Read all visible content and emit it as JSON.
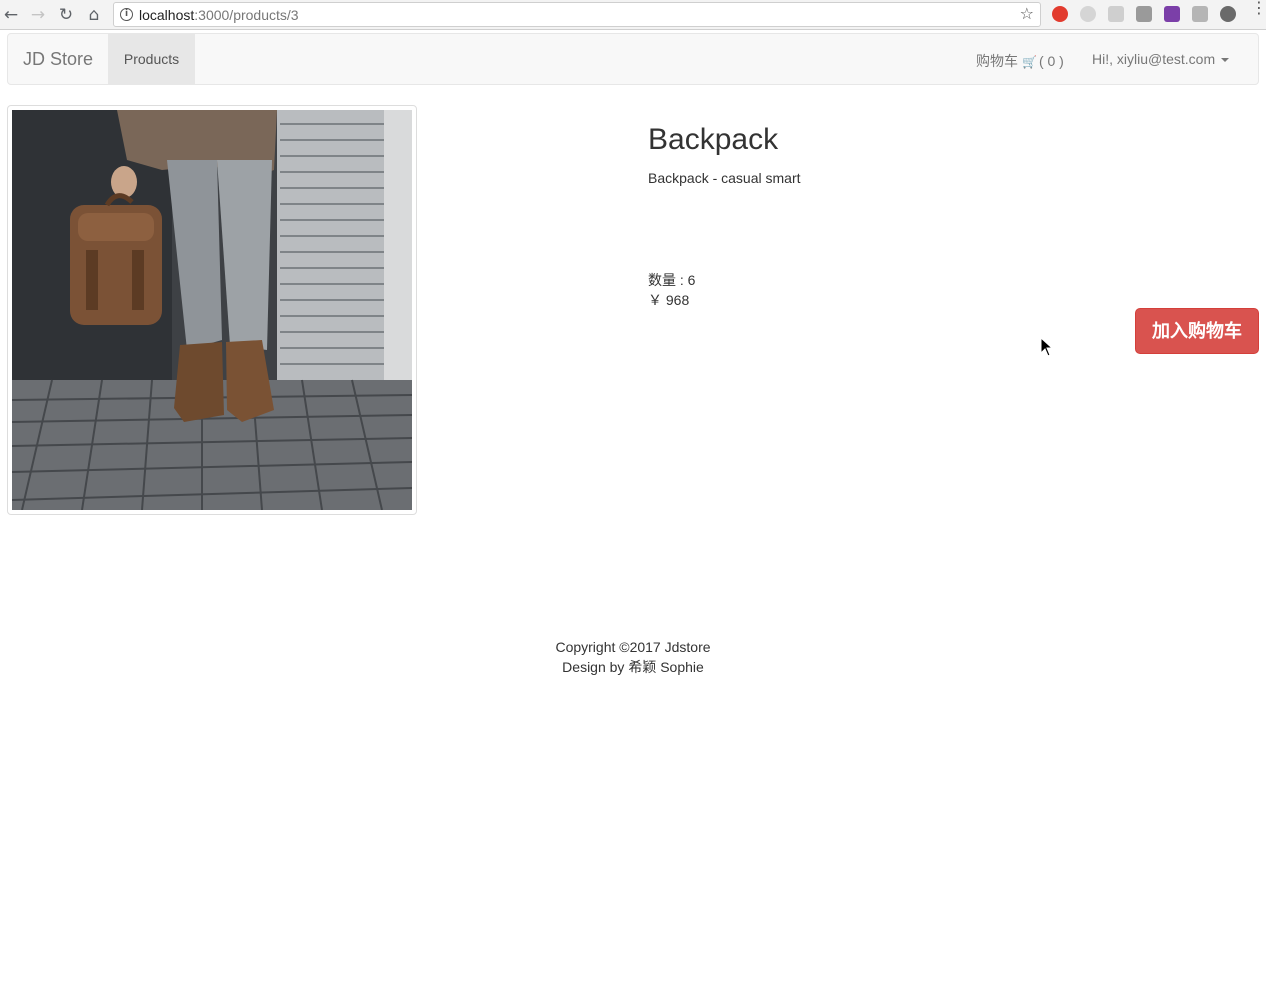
{
  "browser": {
    "url_host": "localhost",
    "url_path": ":3000/products/3"
  },
  "navbar": {
    "brand": "JD Store",
    "products_label": "Products",
    "cart_label": "购物车",
    "cart_count": "( 0 )",
    "user_label": "Hi!, xiyliu@test.com"
  },
  "product": {
    "title": "Backpack",
    "description": "Backpack - casual smart",
    "quantity": "数量 : 6",
    "price": "￥ 968",
    "add_to_cart_label": "加入购物车"
  },
  "footer": {
    "copyright": "Copyright ©2017 Jdstore",
    "credit": "Design by 希颖 Sophie"
  },
  "colors": {
    "danger_button": "#d9534f",
    "navbar_bg": "#f8f8f8",
    "active_nav_bg": "#e7e7e7"
  }
}
